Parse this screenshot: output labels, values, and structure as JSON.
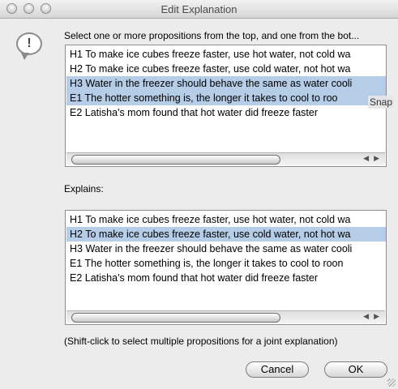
{
  "window": {
    "title": "Edit Explanation"
  },
  "prompt": "Select one or more propositions from the top, and one from the bot...",
  "top_list": {
    "items": [
      {
        "label": "H1 To make ice cubes freeze faster, use hot water, not cold wa",
        "selected": false
      },
      {
        "label": "H2 To make ice cubes freeze faster, use cold water, not hot wa",
        "selected": false
      },
      {
        "label": "H3 Water in the freezer should behave the same as water cooli",
        "selected": true
      },
      {
        "label": "E1 The hotter something is, the longer it takes to cool to roo",
        "selected": true
      },
      {
        "label": "E2 Latisha's mom found that hot water did freeze faster",
        "selected": false
      }
    ]
  },
  "explains_label": "Explains:",
  "bottom_list": {
    "items": [
      {
        "label": "H1 To make ice cubes freeze faster, use hot water, not cold wa",
        "selected": false
      },
      {
        "label": "H2 To make ice cubes freeze faster, use cold water, not hot wa",
        "selected": true
      },
      {
        "label": "H3 Water in the freezer should behave the same as water cooli",
        "selected": false
      },
      {
        "label": "E1 The hotter something is, the longer it takes to cool to roon",
        "selected": false
      },
      {
        "label": "E2 Latisha's mom found that hot water did freeze faster",
        "selected": false
      }
    ]
  },
  "overlay_text": "Snap",
  "hint": "(Shift-click to select multiple propositions for a joint explanation)",
  "buttons": {
    "cancel": "Cancel",
    "ok": "OK"
  },
  "colors": {
    "selection": "#b5cde6",
    "window_bg": "#ececec"
  }
}
